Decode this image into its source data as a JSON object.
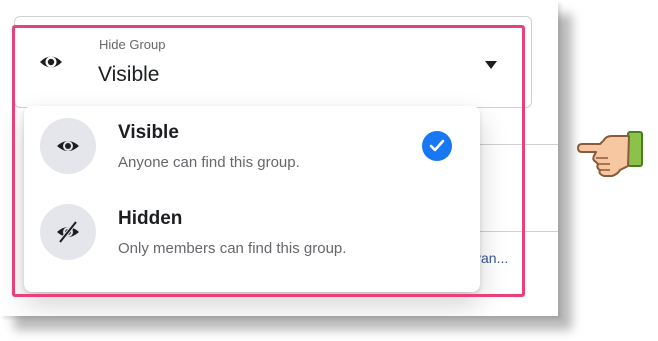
{
  "select": {
    "label": "Hide Group",
    "value": "Visible",
    "icon": "eye-icon"
  },
  "options": [
    {
      "title": "Visible",
      "description": "Anyone can find this group.",
      "icon": "eye-icon",
      "selected": true
    },
    {
      "title": "Hidden",
      "description": "Only members can find this group.",
      "icon": "eye-slash-icon",
      "selected": false
    }
  ],
  "background": {
    "link_fragment": "van..."
  },
  "colors": {
    "accent": "#1877f2",
    "highlight": "#e8407a",
    "icon_bg": "#e4e6eb"
  },
  "annotation": {
    "icon": "pointing-hand-icon"
  }
}
